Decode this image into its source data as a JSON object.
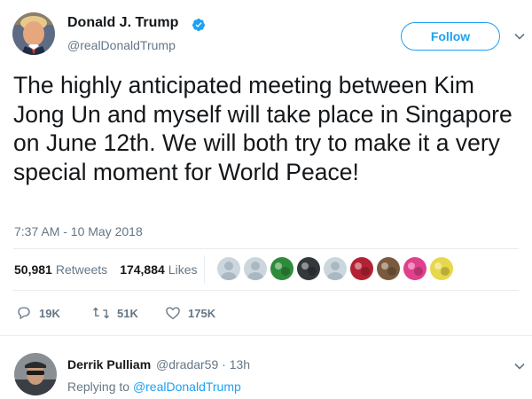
{
  "author": {
    "name": "Donald J. Trump",
    "handle": "@realDonaldTrump",
    "follow_label": "Follow"
  },
  "tweet": {
    "text": "The highly anticipated meeting between Kim Jong Un and myself will take place in Singapore on June 12th. We will both try to make it a very special moment for World Peace!",
    "timestamp": "7:37 AM - 10 May 2018"
  },
  "stats": {
    "retweets_count": "50,981",
    "retweets_label": "Retweets",
    "likes_count": "174,884",
    "likes_label": "Likes"
  },
  "likers": [
    {
      "icon": "default-avatar-icon",
      "color": "#aab8c2"
    },
    {
      "icon": "default-avatar-icon",
      "color": "#aab8c2"
    },
    {
      "icon": "green-profile-icon",
      "color": "#2e8b3a"
    },
    {
      "icon": "dark-profile-icon",
      "color": "#33383d"
    },
    {
      "icon": "default-avatar-icon",
      "color": "#aab8c2"
    },
    {
      "icon": "flag-profile-icon",
      "color": "#b22234"
    },
    {
      "icon": "portrait-profile-icon",
      "color": "#7a5a3e"
    },
    {
      "icon": "pink-profile-icon",
      "color": "#e0408c"
    },
    {
      "icon": "yellow-profile-icon",
      "color": "#e6d84a"
    }
  ],
  "actions": {
    "replies": "19K",
    "retweets": "51K",
    "likes": "175K"
  },
  "reply": {
    "name": "Derrik Pulliam",
    "handle_time": "@dradar59 · 13h",
    "replying_prefix": "Replying to ",
    "replying_to": "@realDonaldTrump"
  },
  "colors": {
    "accent": "#1da1f2",
    "text": "#14171a",
    "muted": "#657786",
    "divider": "#e6ecf0"
  }
}
